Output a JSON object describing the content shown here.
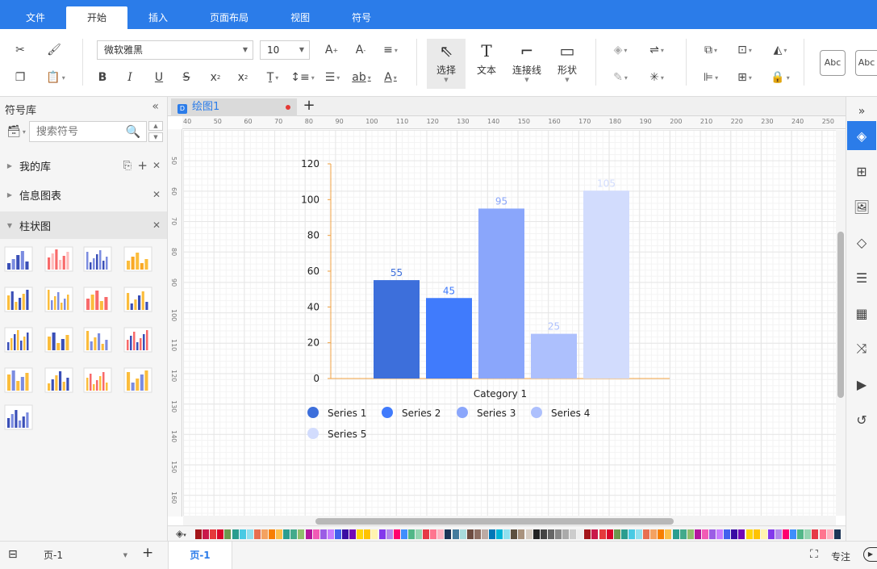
{
  "menu": {
    "tabs": [
      {
        "label": "文件",
        "active": false
      },
      {
        "label": "开始",
        "active": true
      },
      {
        "label": "插入",
        "active": false
      },
      {
        "label": "页面布局",
        "active": false
      },
      {
        "label": "视图",
        "active": false
      },
      {
        "label": "符号",
        "active": false
      }
    ]
  },
  "toolbar": {
    "font_name": "微软雅黑",
    "font_size": "10",
    "select_label": "选择",
    "text_label": "文本",
    "connector_label": "连接线",
    "shape_label": "形状",
    "style_sample_1": "Abc",
    "style_sample_2": "Abc"
  },
  "sidebar": {
    "title": "符号库",
    "search_placeholder": "搜索符号",
    "libraries": [
      {
        "label": "我的库",
        "open": false
      },
      {
        "label": "信息图表",
        "open": false
      },
      {
        "label": "柱状图",
        "open": true
      }
    ]
  },
  "document": {
    "tab_label": "绘图1",
    "unsaved": true
  },
  "ruler": {
    "h_ticks": [
      "40",
      "50",
      "60",
      "70",
      "80",
      "90",
      "100",
      "110",
      "120",
      "130",
      "140",
      "150",
      "160",
      "170",
      "180",
      "190",
      "200",
      "210",
      "220",
      "230",
      "240",
      "250"
    ],
    "v_ticks": [
      "50",
      "60",
      "70",
      "80",
      "90",
      "100",
      "110",
      "120",
      "130",
      "140",
      "150",
      "160"
    ]
  },
  "chart_data": {
    "type": "bar",
    "categories": [
      "Category 1"
    ],
    "xlabel": "Category 1",
    "ylim": [
      0,
      120
    ],
    "yticks": [
      "0",
      "20",
      "40",
      "60",
      "80",
      "100",
      "120"
    ],
    "series": [
      {
        "name": "Series 1",
        "values": [
          55
        ],
        "label": "55",
        "color": "#3d6fdb"
      },
      {
        "name": "Series 2",
        "values": [
          45
        ],
        "label": "45",
        "color": "#407bfc"
      },
      {
        "name": "Series 3",
        "values": [
          95
        ],
        "label": "95",
        "color": "#8aa6fb"
      },
      {
        "name": "Series 4",
        "values": [
          25
        ],
        "label": "25",
        "color": "#adc0fd"
      },
      {
        "name": "Series 5",
        "values": [
          105
        ],
        "label": "105",
        "color": "#d2dcfd"
      }
    ],
    "legend": "bottom",
    "grid": true
  },
  "colors": {
    "accent": "#2b7ce9",
    "axis": "#f0a040"
  },
  "statusbar": {
    "page_selector": "页-1",
    "page_tab": "页-1",
    "focus_label": "专注"
  }
}
